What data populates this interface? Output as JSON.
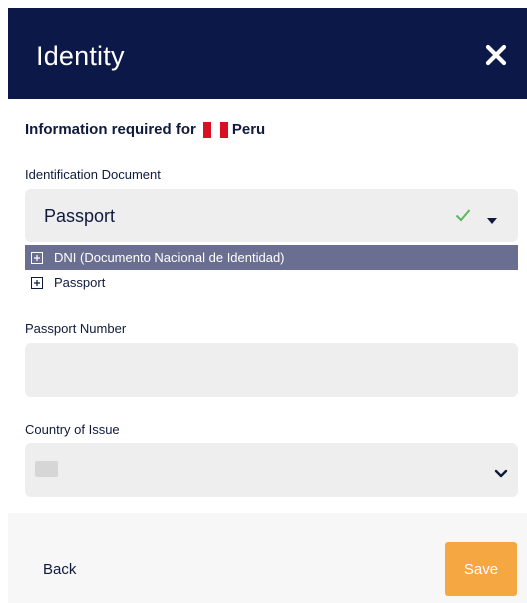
{
  "header": {
    "title": "Identity",
    "close_icon": "close-icon"
  },
  "info": {
    "prefix": "Information required for",
    "country": "Peru",
    "flag_icon": "peru-flag-icon"
  },
  "id_document": {
    "label": "Identification Document",
    "selected": "Passport",
    "options": [
      {
        "label": "DNI (Documento Nacional de Identidad)",
        "highlighted": true
      },
      {
        "label": "Passport",
        "highlighted": false
      }
    ]
  },
  "passport_number": {
    "label": "Passport Number",
    "value": "",
    "placeholder": ""
  },
  "country_of_issue": {
    "label": "Country of Issue",
    "value": ""
  },
  "footer": {
    "back_label": "Back",
    "save_label": "Save"
  },
  "colors": {
    "header_bg": "#0c1848",
    "save_bg": "#f5a742",
    "highlight_bg": "#6a6f91",
    "check": "#5cb85c"
  }
}
